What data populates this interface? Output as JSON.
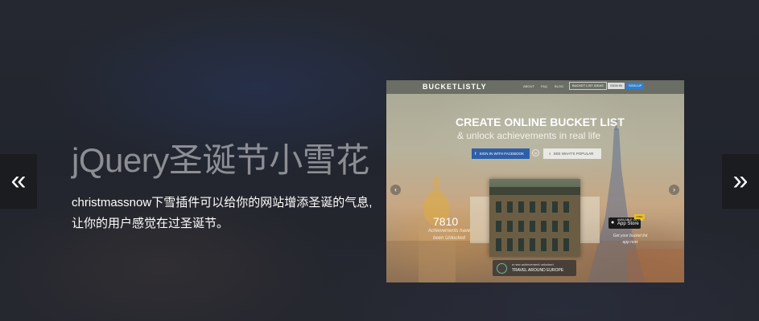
{
  "nav": {
    "prev_label": "«",
    "next_label": "»"
  },
  "slide": {
    "title": "jQuery圣诞节小雪花",
    "description": "christmassnow下雪插件可以给你的网站增添圣诞的气息,让你的用户感觉在过圣诞节。"
  },
  "preview": {
    "brand": "BUCKETLISTLY",
    "top_links": [
      "ABOUT",
      "FAQ",
      "BLOG"
    ],
    "ideas_button": "BUCKET LIST IDEAS",
    "sign_in_button": "SIGN IN",
    "sign_up_button": "SIGN UP",
    "hero_title": "CREATE ONLINE BUCKET LIST",
    "hero_subtitle": "& unlock achievements in real life",
    "facebook_button": "SIGN IN WITH FACEBOOK",
    "or_label": "or",
    "popular_button": "SEE WHAT'S POPULAR",
    "prev_arrow": "‹",
    "next_arrow": "›",
    "stat_number": "7810",
    "stat_text": "Achievements have been Unlocked",
    "card_caption_small": "a new achievement unlocked",
    "card_caption": "TRAVEL AROUND EUROPE",
    "app_store_small": "AVAILABLE ON THE",
    "app_store_big": "App Store",
    "app_badge": "FREE",
    "app_text": "Get your bucket list app now"
  },
  "colors": {
    "background": "#24272e",
    "title": "#8c8e94",
    "description": "#ffffff",
    "nav_button_bg": "#1b1c20",
    "facebook_blue": "#2f5fa8"
  }
}
